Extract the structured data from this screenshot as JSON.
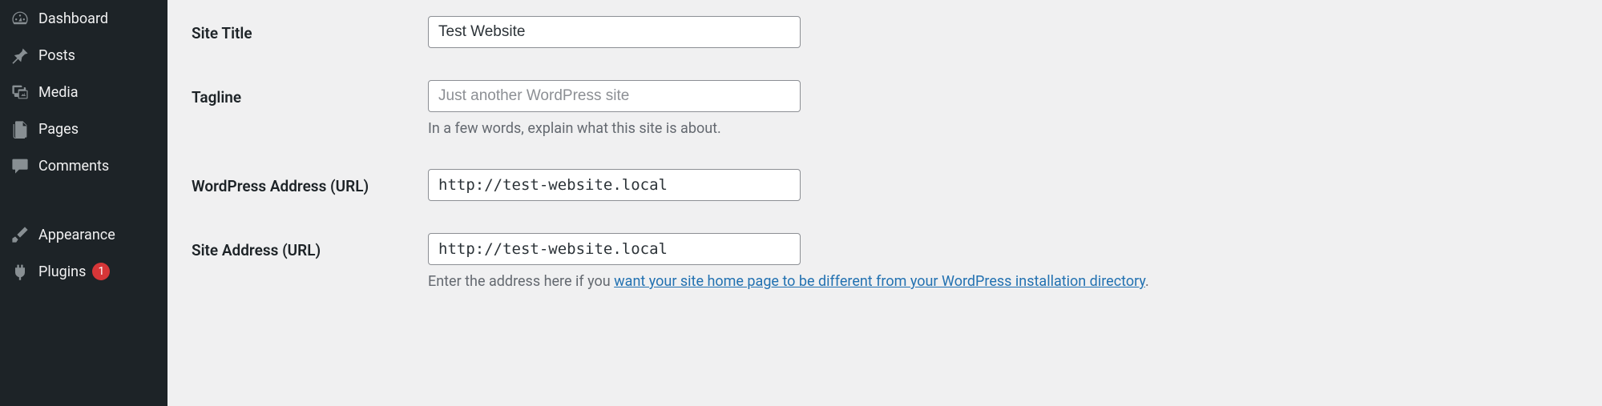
{
  "sidebar": {
    "items": [
      {
        "label": "Dashboard",
        "icon": "dashboard"
      },
      {
        "label": "Posts",
        "icon": "pin"
      },
      {
        "label": "Media",
        "icon": "media"
      },
      {
        "label": "Pages",
        "icon": "pages"
      },
      {
        "label": "Comments",
        "icon": "comment"
      },
      {
        "label": "Appearance",
        "icon": "brush"
      },
      {
        "label": "Plugins",
        "icon": "plug",
        "badge": "1"
      }
    ]
  },
  "form": {
    "site_title": {
      "label": "Site Title",
      "value": "Test Website"
    },
    "tagline": {
      "label": "Tagline",
      "placeholder": "Just another WordPress site",
      "help": "In a few words, explain what this site is about."
    },
    "wp_address": {
      "label": "WordPress Address (URL)",
      "value": "http://test-website.local"
    },
    "site_address": {
      "label": "Site Address (URL)",
      "value": "http://test-website.local",
      "help_prefix": "Enter the address here if you ",
      "help_link": "want your site home page to be different from your WordPress installation directory",
      "help_suffix": "."
    }
  }
}
